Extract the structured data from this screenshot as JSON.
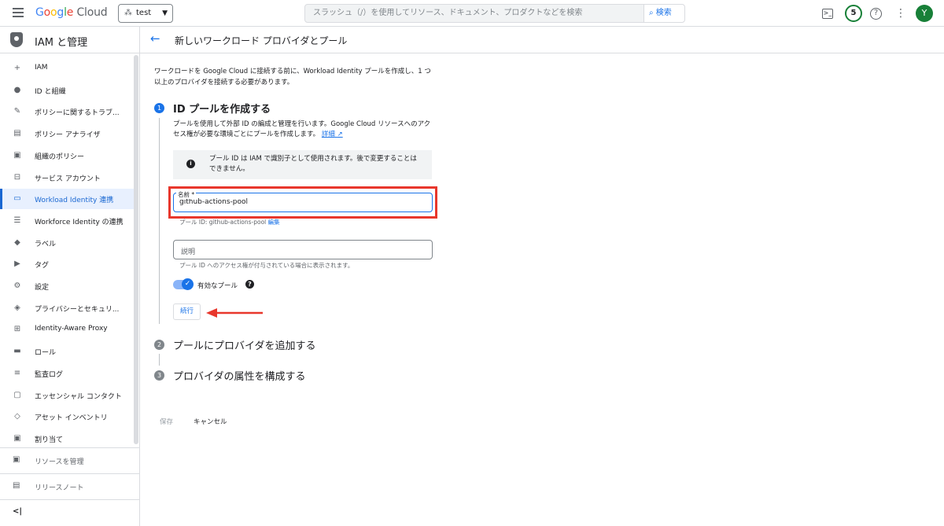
{
  "topbar": {
    "product": {
      "g1": "G",
      "g2": "o",
      "g3": "o",
      "g4": "g",
      "g5": "l",
      "g6": "e",
      "cloud": " Cloud"
    },
    "project": "test",
    "search_placeholder": "スラッシュ（/）を使用してリソース、ドキュメント、プロダクトなどを検索",
    "search_button": "検索",
    "notification_count": "5",
    "avatar_initial": "Y"
  },
  "sidebar": {
    "title": "IAM と管理",
    "items": [
      {
        "label": "IAM",
        "icon": "person-add-icon",
        "glyph": "+"
      },
      {
        "label": "ID と組織",
        "icon": "account-circle-icon",
        "glyph": "●"
      },
      {
        "label": "ポリシーに関するトラブ...",
        "icon": "wrench-icon",
        "glyph": "✎"
      },
      {
        "label": "ポリシー アナライザ",
        "icon": "document-search-icon",
        "glyph": "▤"
      },
      {
        "label": "組織のポリシー",
        "icon": "document-icon",
        "glyph": "▣"
      },
      {
        "label": "サービス アカウント",
        "icon": "service-account-icon",
        "glyph": "⊟"
      },
      {
        "label": "Workload Identity 連携",
        "icon": "workload-identity-icon",
        "glyph": "▭"
      },
      {
        "label": "Workforce Identity の連携",
        "icon": "list-icon",
        "glyph": "☰"
      },
      {
        "label": "ラベル",
        "icon": "tag-icon",
        "glyph": "◆"
      },
      {
        "label": "タグ",
        "icon": "tag-arrow-icon",
        "glyph": "▶"
      },
      {
        "label": "設定",
        "icon": "gear-icon",
        "glyph": "⚙"
      },
      {
        "label": "プライバシーとセキュリ...",
        "icon": "shield-icon",
        "glyph": "◈"
      },
      {
        "label": "Identity-Aware Proxy",
        "icon": "proxy-icon",
        "glyph": "⊞"
      },
      {
        "label": "ロール",
        "icon": "roles-icon",
        "glyph": "▬"
      },
      {
        "label": "監査ログ",
        "icon": "audit-log-icon",
        "glyph": "≡"
      },
      {
        "label": "エッセンシャル コンタクト",
        "icon": "contact-icon",
        "glyph": "▢"
      },
      {
        "label": "アセット インベントリ",
        "icon": "inventory-icon",
        "glyph": "◇"
      },
      {
        "label": "割り当て",
        "icon": "quota-icon",
        "glyph": "▣"
      }
    ],
    "manage_resources": "リソースを管理",
    "release_notes": "リリースノート",
    "collapse": "<|"
  },
  "page": {
    "back": "←",
    "title": "新しいワークロード プロバイダとプール",
    "intro": "ワークロードを Google Cloud に接続する前に、Workload Identity プールを作成し、1 つ以上のプロバイダを接続する必要があります。",
    "step1": {
      "number": "1",
      "title": "ID プールを作成する",
      "description": "プールを使用して外部 ID の編成と管理を行います。Google Cloud リソースへのアクセス権が必要な環境ごとにプールを作成します。",
      "details_link": "詳細",
      "info": "プール ID は IAM で識別子として使用されます。後で変更することはできません。",
      "name_label": "名前 *",
      "name_value": "github-actions-pool",
      "pool_id_hint": "プール ID: github-actions-pool",
      "edit_link": "編集",
      "description_placeholder": "説明",
      "description_hint": "プール ID へのアクセス権が付与されている場合に表示されます。",
      "enable_label": "有効なプール",
      "continue_button": "続行"
    },
    "step2": {
      "number": "2",
      "title": "プールにプロバイダを追加する"
    },
    "step3": {
      "number": "3",
      "title": "プロバイダの属性を構成する"
    },
    "save_button": "保存",
    "cancel_button": "キャンセル"
  },
  "colors": {
    "accent": "#1a73e8",
    "highlight": "#e8372c"
  }
}
